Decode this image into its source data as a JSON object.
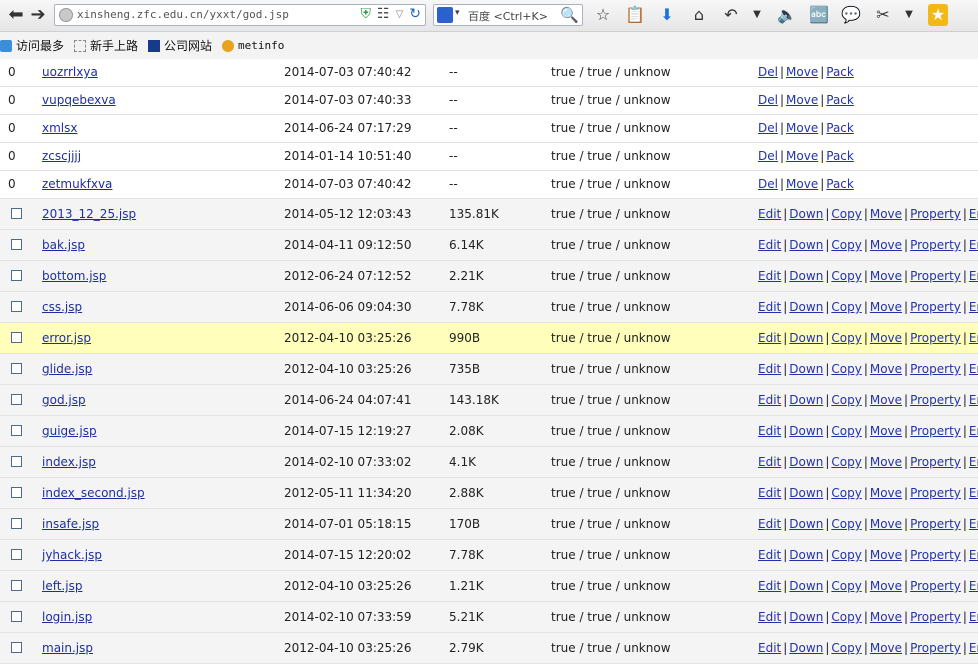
{
  "browser": {
    "url": "xinsheng.zfc.edu.cn/yxxt/god.jsp",
    "search_engine": "百度",
    "search_placeholder": "百度 <Ctrl+K>",
    "icons": [
      "back-icon",
      "forward-icon",
      "site-icon",
      "shield-icon",
      "qr-code-icon",
      "dropdown-icon",
      "refresh-icon",
      "star-icon",
      "clipboard-icon",
      "download-icon",
      "home-icon",
      "undo-icon",
      "menu-caret-icon",
      "volume-icon",
      "translate-icon",
      "comment-icon",
      "crop-icon",
      "menu-caret-icon",
      "favorites-icon"
    ]
  },
  "bookmarks": [
    {
      "label": "访问最多",
      "icon": "frequent-icon"
    },
    {
      "label": "新手上路",
      "icon": "newbie-icon"
    },
    {
      "label": "公司网站",
      "icon": "company-icon"
    },
    {
      "label": "metinfo",
      "icon": "metinfo-icon"
    }
  ],
  "dirs": [
    {
      "mark": "0",
      "name": "uozrrlxya",
      "time": "2014-07-03 07:40:42",
      "size": "--",
      "perm": "true / true / unknow"
    },
    {
      "mark": "0",
      "name": "vupqebexva",
      "time": "2014-07-03 07:40:33",
      "size": "--",
      "perm": "true / true / unknow"
    },
    {
      "mark": "0",
      "name": "xmlsx",
      "time": "2014-06-24 07:17:29",
      "size": "--",
      "perm": "true / true / unknow"
    },
    {
      "mark": "0",
      "name": "zcscjjjj",
      "time": "2014-01-14 10:51:40",
      "size": "--",
      "perm": "true / true / unknow"
    },
    {
      "mark": "0",
      "name": "zetmukfxva",
      "time": "2014-07-03 07:40:42",
      "size": "--",
      "perm": "true / true / unknow"
    }
  ],
  "dir_actions": {
    "del": "Del",
    "move": "Move",
    "pack": "Pack"
  },
  "files": [
    {
      "name": "2013_12_25.jsp",
      "time": "2014-05-12 12:03:43",
      "size": "135.81K",
      "perm": "true / true / unknow"
    },
    {
      "name": "bak.jsp",
      "time": "2014-04-11 09:12:50",
      "size": "6.14K",
      "perm": "true / true / unknow"
    },
    {
      "name": "bottom.jsp",
      "time": "2012-06-24 07:12:52",
      "size": "2.21K",
      "perm": "true / true / unknow"
    },
    {
      "name": "css.jsp",
      "time": "2014-06-06 09:04:30",
      "size": "7.78K",
      "perm": "true / true / unknow"
    },
    {
      "name": "error.jsp",
      "time": "2012-04-10 03:25:26",
      "size": "990B",
      "perm": "true / true / unknow",
      "highlighted": true
    },
    {
      "name": "glide.jsp",
      "time": "2012-04-10 03:25:26",
      "size": "735B",
      "perm": "true / true / unknow"
    },
    {
      "name": "god.jsp",
      "time": "2014-06-24 04:07:41",
      "size": "143.18K",
      "perm": "true / true / unknow"
    },
    {
      "name": "guige.jsp",
      "time": "2014-07-15 12:19:27",
      "size": "2.08K",
      "perm": "true / true / unknow"
    },
    {
      "name": "index.jsp",
      "time": "2014-02-10 07:33:02",
      "size": "4.1K",
      "perm": "true / true / unknow"
    },
    {
      "name": "index_second.jsp",
      "time": "2012-05-11 11:34:20",
      "size": "2.88K",
      "perm": "true / true / unknow"
    },
    {
      "name": "insafe.jsp",
      "time": "2014-07-01 05:18:15",
      "size": "170B",
      "perm": "true / true / unknow"
    },
    {
      "name": "jyhack.jsp",
      "time": "2014-07-15 12:20:02",
      "size": "7.78K",
      "perm": "true / true / unknow"
    },
    {
      "name": "left.jsp",
      "time": "2012-04-10 03:25:26",
      "size": "1.21K",
      "perm": "true / true / unknow"
    },
    {
      "name": "login.jsp",
      "time": "2014-02-10 07:33:59",
      "size": "5.21K",
      "perm": "true / true / unknow"
    },
    {
      "name": "main.jsp",
      "time": "2012-04-10 03:25:26",
      "size": "2.79K",
      "perm": "true / true / unknow"
    }
  ],
  "file_actions": {
    "edit": "Edit",
    "down": "Down",
    "copy": "Copy",
    "move": "Move",
    "property": "Property",
    "enter": "Ente"
  },
  "colors": {
    "highlight_row": "#ffffbb",
    "link": "#2233aa",
    "file_row": "#f4f4f4"
  }
}
